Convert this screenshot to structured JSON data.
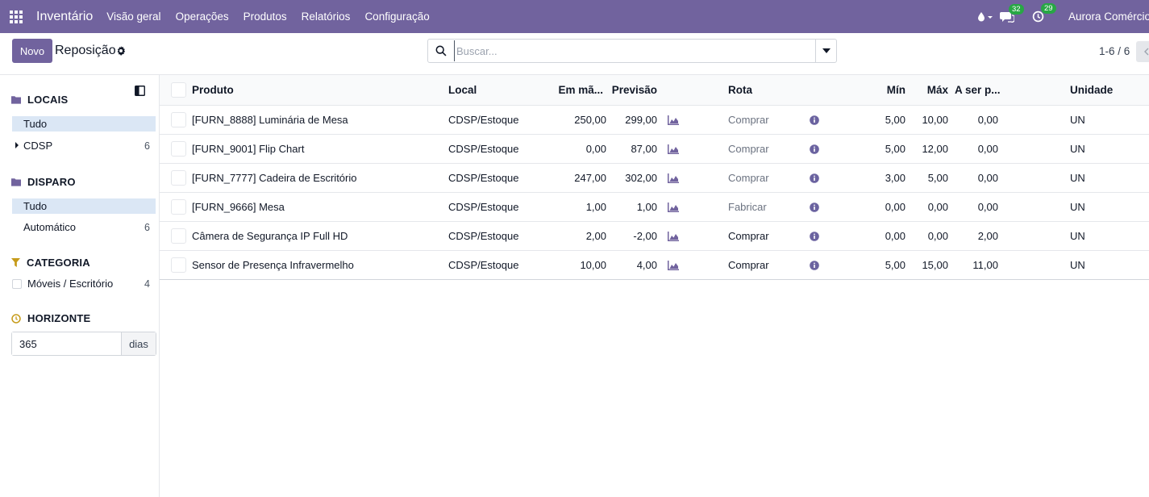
{
  "topnav": {
    "app_title": "Inventário",
    "menu": [
      "Visão geral",
      "Operações",
      "Produtos",
      "Relatórios",
      "Configuração"
    ],
    "messages_count": "32",
    "activities_count": "29",
    "company": "Aurora Comércio"
  },
  "control": {
    "new_label": "Novo",
    "title": "Reposição",
    "search_placeholder": "Buscar...",
    "pager": "1-6 / 6"
  },
  "sidebar": {
    "locations": {
      "title": "LOCAIS",
      "items": [
        {
          "label": "Tudo",
          "count": ""
        },
        {
          "label": "CDSP",
          "count": "6"
        }
      ]
    },
    "trigger": {
      "title": "DISPARO",
      "items": [
        {
          "label": "Tudo",
          "count": ""
        },
        {
          "label": "Automático",
          "count": "6"
        }
      ]
    },
    "category": {
      "title": "CATEGORIA",
      "items": [
        {
          "label": "Móveis / Escritório",
          "count": "4"
        }
      ]
    },
    "horizon": {
      "title": "HORIZONTE",
      "value": "365",
      "unit": "dias"
    }
  },
  "table": {
    "headers": {
      "product": "Produto",
      "location": "Local",
      "on_hand": "Em mã...",
      "forecast": "Previsão",
      "route": "Rota",
      "min": "Mín",
      "max": "Máx",
      "to_order": "A ser p...",
      "unit": "Unidade"
    },
    "rows": [
      {
        "product": "[FURN_8888] Luminária de Mesa",
        "location": "CDSP/Estoque",
        "on_hand": "250,00",
        "forecast": "299,00",
        "route": "Comprar",
        "route_muted": true,
        "min": "5,00",
        "max": "10,00",
        "to_order": "0,00",
        "unit": "UN"
      },
      {
        "product": "[FURN_9001] Flip Chart",
        "location": "CDSP/Estoque",
        "on_hand": "0,00",
        "forecast": "87,00",
        "route": "Comprar",
        "route_muted": true,
        "min": "5,00",
        "max": "12,00",
        "to_order": "0,00",
        "unit": "UN"
      },
      {
        "product": "[FURN_7777] Cadeira de Escritório",
        "location": "CDSP/Estoque",
        "on_hand": "247,00",
        "forecast": "302,00",
        "route": "Comprar",
        "route_muted": true,
        "min": "3,00",
        "max": "5,00",
        "to_order": "0,00",
        "unit": "UN"
      },
      {
        "product": "[FURN_9666] Mesa",
        "location": "CDSP/Estoque",
        "on_hand": "1,00",
        "forecast": "1,00",
        "route": "Fabricar",
        "route_muted": true,
        "min": "0,00",
        "max": "0,00",
        "to_order": "0,00",
        "unit": "UN"
      },
      {
        "product": "Câmera de Segurança IP Full HD",
        "location": "CDSP/Estoque",
        "on_hand": "2,00",
        "forecast": "-2,00",
        "route": "Comprar",
        "route_muted": false,
        "min": "0,00",
        "max": "0,00",
        "to_order": "2,00",
        "unit": "UN"
      },
      {
        "product": "Sensor de Presença Infravermelho",
        "location": "CDSP/Estoque",
        "on_hand": "10,00",
        "forecast": "4,00",
        "route": "Comprar",
        "route_muted": false,
        "min": "5,00",
        "max": "15,00",
        "to_order": "11,00",
        "unit": "UN"
      }
    ]
  },
  "colors": {
    "brand": "#71639e",
    "badge": "#28a745",
    "active_filter": "#dbe7f5",
    "horizon_icon": "#c69b1a"
  }
}
